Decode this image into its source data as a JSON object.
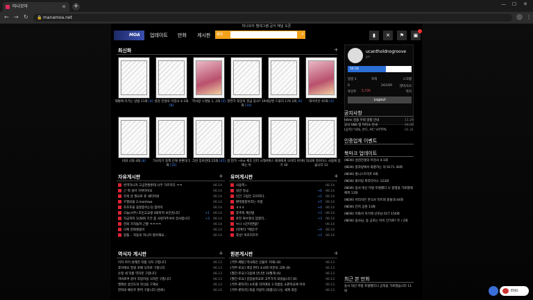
{
  "browser": {
    "tab_title": "마나모아",
    "url": "manamoa.net"
  },
  "header": {
    "notice": "마나모아 텔레그램 공식 채널 오픈",
    "logo": "MOA",
    "menu": [
      "업데이트",
      "만화",
      "게시판"
    ],
    "search_select": "제목"
  },
  "latest": {
    "title": "최신화",
    "row1": [
      {
        "title": "재벌에 이기는 방법 11화",
        "count": "[4]"
      },
      {
        "title": "성검 전생의 마검사 4-1화",
        "count": "[8]"
      },
      {
        "title": "역사랑 스캔들 1, 2화",
        "count": "[4]"
      },
      {
        "title": "현연가 최강의 현금 용사? 19화",
        "count": "[10]"
      },
      {
        "title": "세상엔 드물지 176.1화",
        "count": "[6]"
      },
      {
        "title": "데이미안 45화",
        "count": "[4]"
      }
    ],
    "row2": [
      {
        "title": "비와 너와 4화",
        "count": "[8]"
      },
      {
        "title": "가사지기 정책 인해 본편대 5화",
        "count": "[35]"
      },
      {
        "title": "크란 장로천대 25화",
        "count": "[45]"
      },
      {
        "title": "감 펀가 ~the 체도 인터 시작에는 아",
        "count": ""
      },
      {
        "title": "바퀴스 에게에게 오아티 아이기 30",
        "count": ""
      },
      {
        "title": "이 희곡에 뮤아이스 사람에 있습니다 12",
        "count": ""
      }
    ]
  },
  "free_board": {
    "title": "자유게시판",
    "items": [
      {
        "text": "번역하니카 고공한발판대 너무 가르치다 ㅋㅋ",
        "comments": "",
        "date": "06.14"
      },
      {
        "text": "근 뭐 실어 가위아이요",
        "comments": "",
        "date": "06.14"
      },
      {
        "text": "자게 글 필요로 쥬 새티아네",
        "comments": "",
        "date": "06.14"
      },
      {
        "text": "우험되을 2.manhwa",
        "comments": "",
        "date": "06.14"
      },
      {
        "text": "조조조을 용항중이는딩 참마이",
        "comments": "",
        "date": "06.14"
      },
      {
        "text": "오늘(사주) 조민고교생 4화마저 보인검니다",
        "comments": "+1",
        "date": "06.14"
      },
      {
        "text": "지금까지 1년8회 기간 좀 사랑하주셔서 감사합니다",
        "comments": "+3",
        "date": "06.14"
      },
      {
        "text": "한화 가지들려 근황 ㅋㅋㅋㅋ",
        "comments": "",
        "date": "06.14"
      },
      {
        "text": "이제 한화랜붐이",
        "comments": "",
        "date": "06.14"
      },
      {
        "text": "항풀... 자동의 하니카 항아해요..",
        "comments": "",
        "date": "06.14"
      }
    ]
  },
  "humor_board": {
    "title": "유머게시판",
    "items": [
      {
        "text": "사용쪽~",
        "comments": "",
        "date": "06.14"
      },
      {
        "text": "실반 뮤금",
        "comments": "+6",
        "date": "06.14"
      },
      {
        "text": "인간 그림인 고이하다..",
        "comments": "+2",
        "date": "06.14"
      },
      {
        "text": "편테펑봉이라는 이름",
        "comments": "+5",
        "date": "06.14"
      },
      {
        "text": "ㅎㅎㅎ",
        "comments": "+4",
        "date": "06.14"
      },
      {
        "text": "후추외 계산법",
        "comments": "+3",
        "date": "06.14"
      },
      {
        "text": "훈친 복수절식 업결리...",
        "comments": "+3",
        "date": "06.14"
      },
      {
        "text": "누나 시간미연없?",
        "comments": "",
        "date": "06.14"
      },
      {
        "text": "[약혹다 \"제압기\"",
        "comments": "+4",
        "date": "06.14"
      },
      {
        "text": "후방! 마조히즈트",
        "comments": "+3",
        "date": "06.14"
      }
    ]
  },
  "translator_board": {
    "title": "역식자 게시판",
    "items": [
      {
        "text": "이자 아이 성해진 작품 식자 구합니다",
        "date": "06.13"
      },
      {
        "text": "후이에요 말걸 포베 식자로 구합니다",
        "date": "06.13"
      },
      {
        "text": "순정 세 작품 역자분 구합니다",
        "date": "06.13"
      },
      {
        "text": "히비로쿠 같이 작업하실 식자분 구합니다",
        "date": "06.13"
      },
      {
        "text": "엘레린 용인도의 작식용 구해요",
        "date": "06.13"
      },
      {
        "text": "연착의 배유즈 편역 구합니다 (완료)",
        "date": "06.10"
      }
    ]
  },
  "raw_board": {
    "title": "원본게시판",
    "items": [
      {
        "text": "[격주-퀘탈] 역사화인 선물이 70화 (8)",
        "date": "06.13"
      },
      {
        "text": "[격주-토요] 게임 판타 소녀와 이분의 고화 (8)",
        "date": "06.13"
      },
      {
        "text": "[월간-토요] 다음에 만나면 10월계 (6)",
        "date": "06.13"
      },
      {
        "text": "[월간-토요] 김장들학교로 고부가지 되었습니다 (8)",
        "date": "06.13"
      },
      {
        "text": "[격주-판타지] 소토를 리카에의 3 작품등 소판학교에 미야",
        "date": "06.13"
      },
      {
        "text": "[격주-판타지] 최을 카원지 [회를식] 나는 세계 최강",
        "date": "06.13"
      }
    ]
  },
  "profile": {
    "username": "ucantholdnogroove",
    "sub": "gm",
    "level_label": "56.56",
    "level_fraction": 0.6,
    "row1_left": "일일 1",
    "row1_mid": "목적",
    "row1_right": "스크랩",
    "row2_left": "0",
    "row2_mid": "24/169",
    "row2_right": "많이/1/2",
    "points_label": "포인트",
    "points_value": "5,735",
    "points_right": "쪽지",
    "logout": "Logout"
  },
  "notice": {
    "title": "공지사항",
    "items": [
      {
        "text": "hitmi 검을 우회 방법 안내",
        "date": "11.29"
      },
      {
        "text": "공식 SNS 및 미러소 안내",
        "date": "04.08"
      },
      {
        "text": "[공지] \"iOS, 안드, PC\" HTTPS",
        "date": "01.31"
      }
    ]
  },
  "partner": {
    "title": "인증업체 이벤트"
  },
  "bookmark": {
    "title": "북마크 업데이트",
    "items": [
      "(NEW) 성검전생의 마검사 4-1화",
      "(NEW) 칼과잎에서 화풍하는 의 9171 36화",
      "(NEW) 홍니스트리트 6화",
      "(NEW) 화이링 파라다이스 123화",
      "(NEW) 용사 대신 마왕 토벌했다 나 광맹을 가로챘에에피 11화",
      "(NEW) 어리석은 한식사 막트회 충돌대 44화",
      "(NEW) 던지 공원 13화",
      "(NEW) 어화서 하기에 산포님 617 156화",
      "(NEW) 용사님, 용 공포는 아이 간가로? 트 / 2화"
    ]
  },
  "recent": {
    "title": "최근 본 만화",
    "items": [
      "용사 대신 마왕 토벌했더니 공적을 가로챘습니다 11화"
    ]
  },
  "lang": "ENG"
}
